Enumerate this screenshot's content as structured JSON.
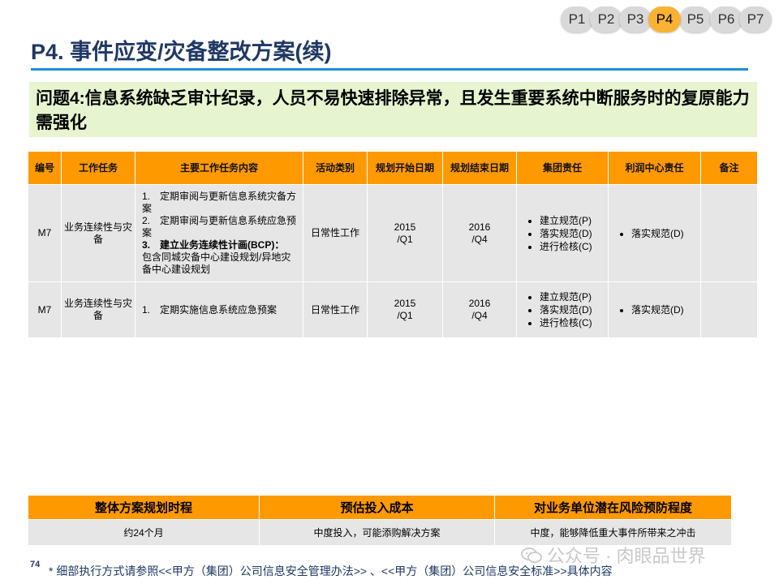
{
  "nav": {
    "pages": [
      "P1",
      "P2",
      "P3",
      "P4",
      "P5",
      "P6",
      "P7"
    ],
    "active": "P4"
  },
  "title": "P4. 事件应变/灾备整改方案(续)",
  "issue": "问题4:信息系统缺乏审计纪录，人员不易快速排除异常，且发生重要系统中断服务时的复原能力需强化",
  "table": {
    "headers": [
      "编号",
      "工作任务",
      "主要工作任务内容",
      "活动类别",
      "规划开始日期",
      "规划结束日期",
      "集团责任",
      "利润中心责任",
      "备注"
    ],
    "rows": [
      {
        "id": "M7",
        "task": "业务连续性与灾备",
        "content": [
          "1.　定期审阅与更新信息系统灾备方案",
          "2.　定期审阅与更新信息系统应急预案",
          "3.　建立业务连续性计画(BCP)：",
          "包含同城灾备中心建设规划/异地灾备中心建设规划"
        ],
        "category": "日常性工作",
        "start": "2015\n/Q1",
        "end": "2016\n/Q4",
        "group": [
          "建立规范(P)",
          "落实规范(D)",
          "进行检核(C)"
        ],
        "profit": [
          "落实规范(D)"
        ],
        "note": ""
      },
      {
        "id": "M7",
        "task": "业务连续性与灾备",
        "content": [
          "1.　定期实施信息系统应急预案"
        ],
        "category": "日常性工作",
        "start": "2015\n/Q1",
        "end": "2016\n/Q4",
        "group": [
          "建立规范(P)",
          "落实规范(D)",
          "进行检核(C)"
        ],
        "profit": [
          "落实规范(D)"
        ],
        "note": ""
      }
    ]
  },
  "summary": {
    "headers": [
      "整体方案规划时程",
      "预估投入成本",
      "对业务单位潜在风险预防程度"
    ],
    "values": [
      "约24个月",
      "中度投入，可能添购解决方案",
      "中度，能够降低重大事件所带来之冲击"
    ]
  },
  "page_number": "74",
  "footnote": "* 细部执行方式请参照<<甲方（集团）公司信息安全管理办法>> 、<<甲方（集团）公司信息安全标准>>具体内容",
  "watermark": "公众号 · 肉眼品世界",
  "colors": {
    "accent": "#ff9900",
    "title": "#1f3864",
    "issue_bg": "#e6f5cf",
    "rule": "#1e90d8",
    "cell_bg": "#e6e6e6",
    "active_pill": "#f9b233"
  }
}
